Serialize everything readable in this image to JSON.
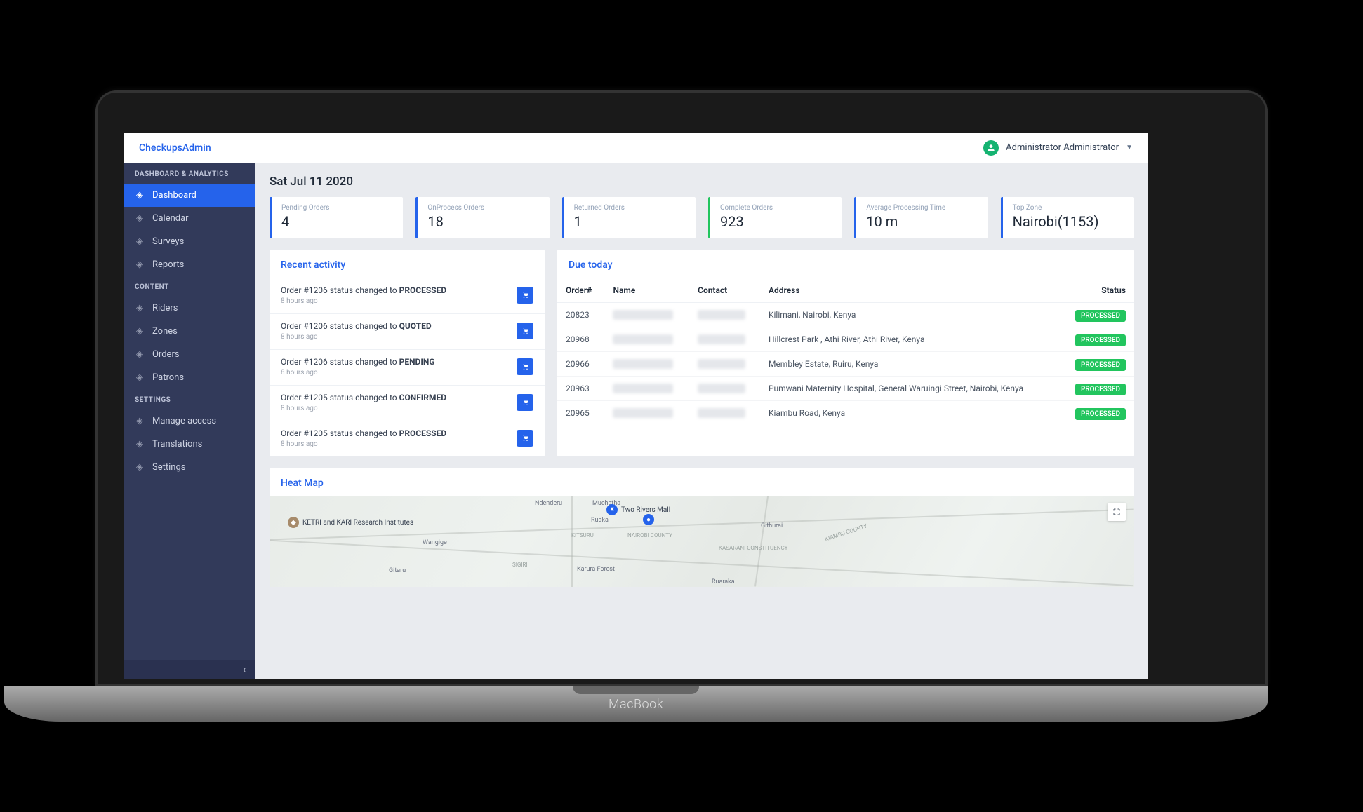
{
  "brand": "CheckupsAdmin",
  "user": {
    "name": "Administrator Administrator"
  },
  "pageTitle": "Sat Jul 11 2020",
  "sidebar": {
    "sections": [
      {
        "title": "DASHBOARD & ANALYTICS",
        "items": [
          {
            "label": "Dashboard",
            "icon": "diamond-icon",
            "active": true
          },
          {
            "label": "Calendar",
            "icon": "calendar-icon"
          },
          {
            "label": "Surveys",
            "icon": "survey-icon"
          },
          {
            "label": "Reports",
            "icon": "report-icon"
          }
        ]
      },
      {
        "title": "CONTENT",
        "items": [
          {
            "label": "Riders",
            "icon": "rider-icon"
          },
          {
            "label": "Zones",
            "icon": "zone-icon"
          },
          {
            "label": "Orders",
            "icon": "order-icon"
          },
          {
            "label": "Patrons",
            "icon": "patron-icon"
          }
        ]
      },
      {
        "title": "SETTINGS",
        "items": [
          {
            "label": "Manage access",
            "icon": "access-icon"
          },
          {
            "label": "Translations",
            "icon": "translate-icon"
          },
          {
            "label": "Settings",
            "icon": "settings-icon"
          }
        ]
      }
    ]
  },
  "stats": [
    {
      "label": "Pending Orders",
      "value": "4",
      "accent": "#2563eb"
    },
    {
      "label": "OnProcess Orders",
      "value": "18",
      "accent": "#2563eb"
    },
    {
      "label": "Returned Orders",
      "value": "1",
      "accent": "#2563eb"
    },
    {
      "label": "Complete Orders",
      "value": "923",
      "accent": "#22c55e"
    },
    {
      "label": "Average Processing Time",
      "value": "10 m",
      "accent": "#2563eb"
    },
    {
      "label": "Top Zone",
      "value": "Nairobi(1153)",
      "accent": "#2563eb"
    }
  ],
  "recent": {
    "title": "Recent activity",
    "items": [
      {
        "prefix": "Order #1206 status changed to ",
        "status": "PROCESSED",
        "time": "8 hours ago"
      },
      {
        "prefix": "Order #1206 status changed to ",
        "status": "QUOTED",
        "time": "8 hours ago"
      },
      {
        "prefix": "Order #1206 status changed to ",
        "status": "PENDING",
        "time": "8 hours ago"
      },
      {
        "prefix": "Order #1205 status changed to ",
        "status": "CONFIRMED",
        "time": "8 hours ago"
      },
      {
        "prefix": "Order #1205 status changed to ",
        "status": "PROCESSED",
        "time": "8 hours ago"
      }
    ]
  },
  "due": {
    "title": "Due today",
    "columns": [
      "Order#",
      "Name",
      "Contact",
      "Address",
      "Status"
    ],
    "rows": [
      {
        "order": "20823",
        "address": "Kilimani, Nairobi, Kenya",
        "status": "PROCESSED"
      },
      {
        "order": "20968",
        "address": "Hillcrest Park , Athi River, Athi River, Kenya",
        "status": "PROCESSED"
      },
      {
        "order": "20966",
        "address": "Membley Estate, Ruiru, Kenya",
        "status": "PROCESSED"
      },
      {
        "order": "20963",
        "address": "Pumwani Maternity Hospital, General Waruingi Street, Nairobi, Kenya",
        "status": "PROCESSED"
      },
      {
        "order": "20965",
        "address": "Kiambu Road, Kenya",
        "status": "PROCESSED"
      }
    ]
  },
  "heatmap": {
    "title": "Heat Map",
    "labels": [
      "Ndenderu",
      "Muchatha",
      "Ruaka",
      "Wangige",
      "Gitaru",
      "KITSURU",
      "NAIROBI COUNTY",
      "Karura Forest",
      "Two Rivers Mall",
      "KETRI and KARI Research Institutes",
      "SIGIRI",
      "Githurai",
      "KASARANI CONSTITUENCY",
      "KIAMBU COUNTY",
      "Ruaraka"
    ]
  },
  "laptop": {
    "brand": "MacBook"
  }
}
